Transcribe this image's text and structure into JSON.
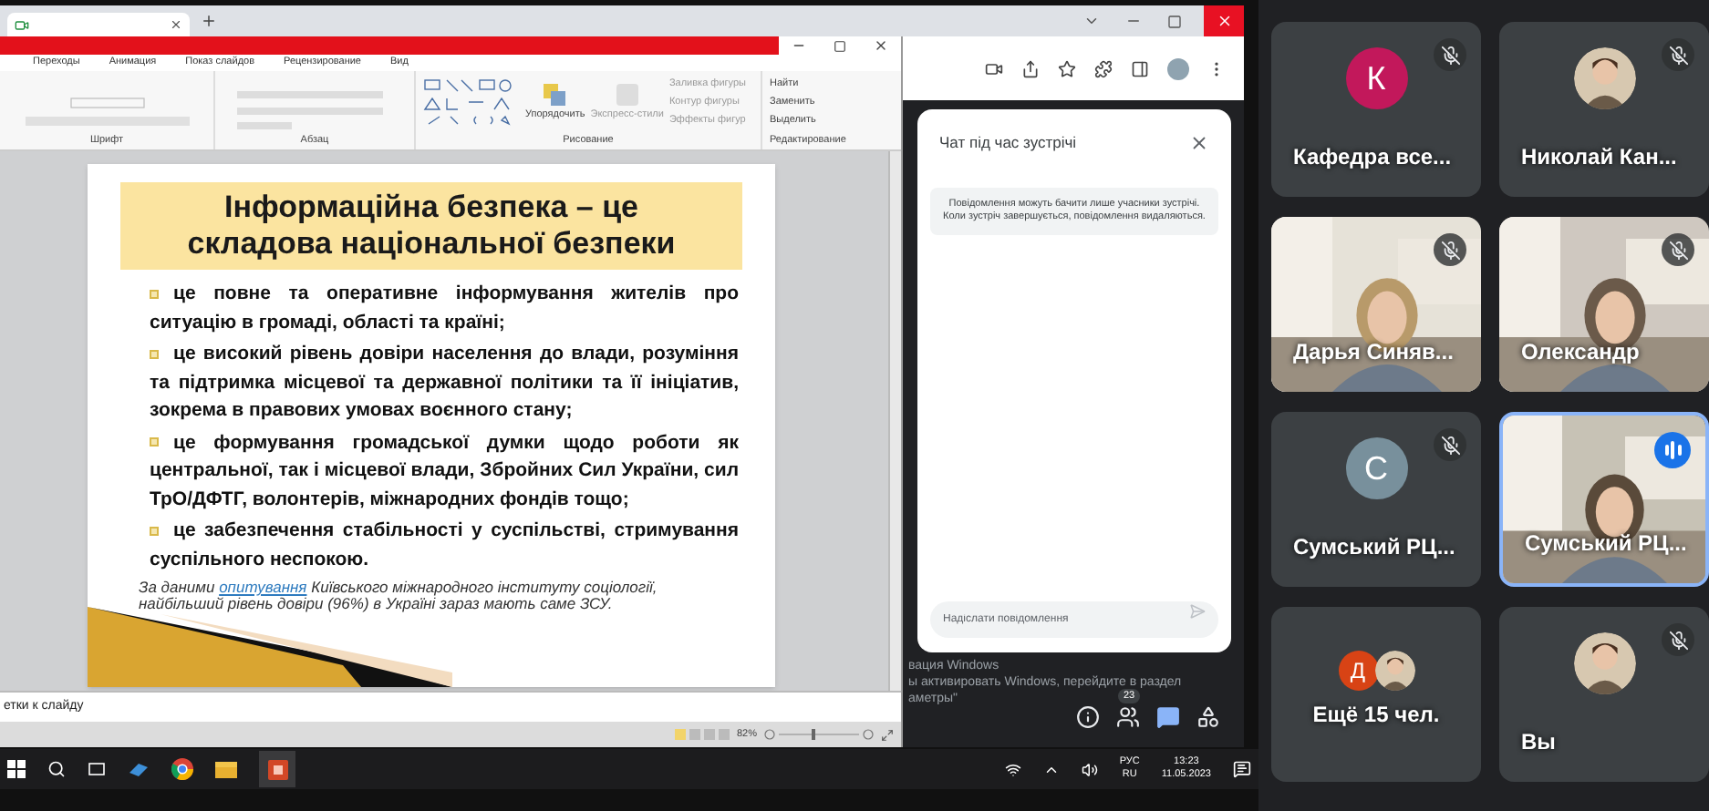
{
  "ppt": {
    "tabs": [
      "Переходы",
      "Анимация",
      "Показ слайдов",
      "Рецензирование",
      "Вид"
    ],
    "ribbon": {
      "font_label": "Шрифт",
      "paragraph_label": "Абзац",
      "drawing_label": "Рисование",
      "arrange": "Упорядочить",
      "quick_styles": "Экспресс-стили",
      "shape_options": [
        "Заливка фигуры",
        "Контур фигуры",
        "Эффекты фигур"
      ],
      "editing_label": "Редактирование",
      "editing_options": [
        "Найти",
        "Заменить",
        "Выделить"
      ]
    },
    "slide": {
      "title_lines": [
        "Інформаційна безпека – це",
        "складова національної безпеки"
      ],
      "bullets": [
        "це повне та оперативне інформування жителів про ситуацію в громаді, області та країні;",
        "це високий рівень довіри населення до влади, розуміння та підтримка місцевої  та державної політики та її ініціатив, зокрема в правових умовах воєнного стану;",
        "це формування громадської думки щодо роботи як центральної, так і місцевої влади, Збройних Сил України, сил ТрО/ДФТГ, волонтерів, міжнародних фондів тощо;",
        "це забезпечення стабільності у суспільстві, стримування суспільного неспокою."
      ],
      "footnote": {
        "before": "За даними",
        "link": "опитування",
        "after": "Київського міжнародного інституту соціології, найбільший рівень довіри (96%) в Україні зараз мають саме ЗСУ."
      }
    },
    "notes": "етки к слайду",
    "zoom": "82%"
  },
  "chat": {
    "title": "Чат під час зустрічі",
    "notice": "Повідомлення можуть бачити лише учасники зустрічі. Коли зустріч завершується, повідомлення видаляються.",
    "placeholder": "Надіслати повідомлення"
  },
  "activation_notice": [
    "вация Windows",
    "ы активировать Windows, перейдите в раздел",
    "аметры\""
  ],
  "meet_controls": [
    {
      "kind": "info",
      "selected": false
    },
    {
      "kind": "people",
      "badge": "23",
      "selected": false
    },
    {
      "kind": "chat",
      "selected": true
    },
    {
      "kind": "activities",
      "selected": false
    }
  ],
  "taskbar": {
    "language": "РУС",
    "layout": "RU",
    "time": "13:23",
    "date": "11.05.2023"
  },
  "participants": [
    {
      "name": "Кафедра все...",
      "kind": "letter",
      "letter": "К",
      "color": "#c2185b",
      "muted": true,
      "speaking": false
    },
    {
      "name": "Николай Кан...",
      "muted": true,
      "speaking": false
    },
    {
      "name": "Дарья Синяв...",
      "kind": "video",
      "muted": true,
      "speaking": false
    },
    {
      "name": "Олександр",
      "kind": "video",
      "muted": true,
      "speaking": false
    },
    {
      "name": "Сумський РЦ...",
      "kind": "letter",
      "letter": "С",
      "color": "#78909c",
      "muted": true,
      "speaking": false
    },
    {
      "name": "Сумський РЦ...",
      "kind": "video",
      "muted": false,
      "speaking": true
    },
    {
      "name": "Ещё 15 чел.",
      "kind": "group",
      "letter": "Д",
      "color": "#d84315",
      "muted": false,
      "speaking": false
    },
    {
      "name": "Вы",
      "muted": true,
      "speaking": false
    }
  ]
}
